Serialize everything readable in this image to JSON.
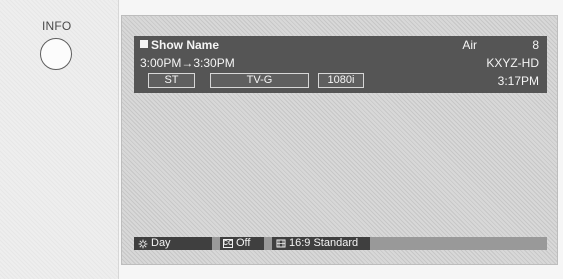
{
  "remote": {
    "info_label": "INFO"
  },
  "banner": {
    "show_name": "Show Name",
    "source": "Air",
    "channel": "8",
    "time_range": "3:00PM→3:30PM",
    "call_sign": "KXYZ-HD",
    "chips": [
      "ST",
      "TV-G",
      "1080i"
    ],
    "current_time": "3:17PM"
  },
  "status_bar": {
    "items": [
      {
        "label": "Day",
        "icon": "brightness-icon"
      },
      {
        "label": "Off",
        "icon": "cc-icon"
      },
      {
        "label": "16:9 Standard",
        "icon": "aspect-ratio-icon"
      }
    ]
  }
}
